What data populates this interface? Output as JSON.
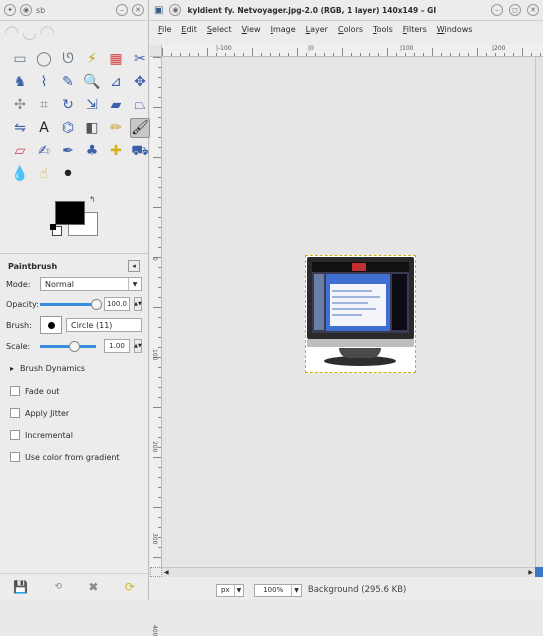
{
  "toolbox": {
    "title_icons": [
      "gimp-icon",
      "window-menu-icon"
    ],
    "title_text": "sb",
    "tools": [
      {
        "name": "rect-select-icon",
        "glyph": "▭",
        "color": "#6a7a8a"
      },
      {
        "name": "ellipse-select-icon",
        "glyph": "◯",
        "color": "#6a7a8a"
      },
      {
        "name": "free-select-icon",
        "glyph": "ᘎ",
        "color": "#6a7a8a"
      },
      {
        "name": "fuzzy-select-icon",
        "glyph": "⚡",
        "color": "#c2a000"
      },
      {
        "name": "select-by-color-icon",
        "glyph": "▦",
        "color": "#d04040"
      },
      {
        "name": "scissors-select-icon",
        "glyph": "✂",
        "color": "#3a60a8"
      },
      {
        "name": "foreground-select-icon",
        "glyph": "♞",
        "color": "#3a60a8"
      },
      {
        "name": "paths-icon",
        "glyph": "⌇",
        "color": "#3a60a8"
      },
      {
        "name": "color-picker-icon",
        "glyph": "✎",
        "color": "#3a60a8"
      },
      {
        "name": "zoom-icon",
        "glyph": "🔍",
        "color": "#3a60a8"
      },
      {
        "name": "measure-icon",
        "glyph": "⊿",
        "color": "#3a60a8"
      },
      {
        "name": "move-icon",
        "glyph": "✥",
        "color": "#3a60a8"
      },
      {
        "name": "align-icon",
        "glyph": "✣",
        "color": "#8a8a8a"
      },
      {
        "name": "crop-icon",
        "glyph": "⌗",
        "color": "#8a8a8a"
      },
      {
        "name": "rotate-icon",
        "glyph": "↻",
        "color": "#3a60a8"
      },
      {
        "name": "scale-icon",
        "glyph": "⇲",
        "color": "#3a60a8"
      },
      {
        "name": "shear-icon",
        "glyph": "▰",
        "color": "#3a60a8"
      },
      {
        "name": "perspective-icon",
        "glyph": "⏢",
        "color": "#3a60a8"
      },
      {
        "name": "flip-icon",
        "glyph": "⇋",
        "color": "#3a60a8"
      },
      {
        "name": "text-icon",
        "glyph": "A",
        "color": "#222222"
      },
      {
        "name": "cage-transform-icon",
        "glyph": "⌬",
        "color": "#3a60a8"
      },
      {
        "name": "bucket-fill-icon",
        "glyph": "◧",
        "color": "#555555"
      },
      {
        "name": "pencil-icon",
        "glyph": "✏",
        "color": "#c8a030"
      },
      {
        "name": "paintbrush-icon",
        "glyph": "🖌",
        "color": "#222222",
        "active": true
      },
      {
        "name": "eraser-icon",
        "glyph": "▱",
        "color": "#d04050"
      },
      {
        "name": "airbrush-icon",
        "glyph": "✍",
        "color": "#3a60a8"
      },
      {
        "name": "ink-icon",
        "glyph": "✒",
        "color": "#3a60a8"
      },
      {
        "name": "clone-icon",
        "glyph": "♣",
        "color": "#3a60a8"
      },
      {
        "name": "heal-icon",
        "glyph": "✚",
        "color": "#d8b020"
      },
      {
        "name": "perspective-clone-icon",
        "glyph": "⛟",
        "color": "#3a60a8"
      },
      {
        "name": "blur-icon",
        "glyph": "💧",
        "color": "#3a78c8"
      },
      {
        "name": "smudge-icon",
        "glyph": "☝",
        "color": "#d8a030"
      },
      {
        "name": "dodge-burn-icon",
        "glyph": "⚫",
        "color": "#222222"
      }
    ],
    "colors": {
      "foreground": "#000000",
      "background": "#ffffff"
    },
    "tool_options": {
      "title": "Paintbrush",
      "mode_label": "Mode:",
      "mode_value": "Normal",
      "opacity_label": "Opacity:",
      "opacity_value": "100.0",
      "opacity_fraction": 1.0,
      "brush_label": "Brush:",
      "brush_value": "Circle (11)",
      "scale_label": "Scale:",
      "scale_value": "1.00",
      "scale_fraction": 0.6,
      "brush_dynamics": "Brush Dynamics",
      "checkboxes": [
        "Fade out",
        "Apply Jitter",
        "Incremental",
        "Use color from gradient"
      ]
    },
    "bottom_icons": [
      "save-options-icon",
      "restore-options-icon",
      "delete-options-icon",
      "reset-options-icon"
    ]
  },
  "image_window": {
    "title": "kyldient fy. Netvoyager.jpg-2.0 (RGB, 1 layer) 140x149 – GI",
    "menu": [
      "File",
      "Edit",
      "Select",
      "View",
      "Image",
      "Layer",
      "Colors",
      "Tools",
      "Filters",
      "Windows"
    ],
    "ruler_labels": [
      "|-100",
      "|0",
      "|100",
      "|200"
    ],
    "vruler_labels": [
      "0",
      "100",
      "200",
      "300",
      "400"
    ],
    "unit": "px",
    "zoom": "100%",
    "status": "Background (295.6 KB)"
  }
}
